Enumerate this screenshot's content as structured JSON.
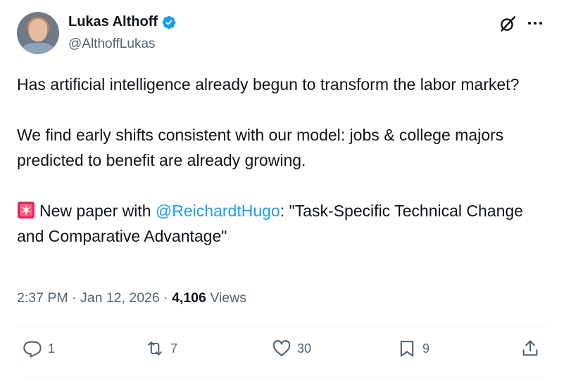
{
  "author": {
    "name": "Lukas Althoff",
    "handle": "@AlthoffLukas"
  },
  "tweet": {
    "paragraph1": "Has artificial intelligence already begun to transform the labor market?",
    "paragraph2": "We find early shifts consistent with our model: jobs & college majors predicted to benefit are already growing.",
    "paragraph3_prefix": "New paper with ",
    "paragraph3_mention": "@ReichardtHugo",
    "paragraph3_suffix": ": \"Task-Specific Technical Change and Comparative Advantage\""
  },
  "meta": {
    "time": "2:37 PM",
    "separator": "·",
    "date": "Jan 12, 2026",
    "views_count": "4,106",
    "views_label": "Views"
  },
  "actions": {
    "replies": "1",
    "reposts": "7",
    "likes": "30",
    "bookmarks": "9"
  },
  "colors": {
    "accent": "#1d9bf0",
    "secondary_text": "#536471",
    "primary_text": "#0f1419"
  },
  "icons": [
    "verified-badge-icon",
    "grok-icon",
    "more-icon",
    "siren-emoji-icon",
    "reply-icon",
    "repost-icon",
    "like-icon",
    "bookmark-icon",
    "share-icon"
  ]
}
